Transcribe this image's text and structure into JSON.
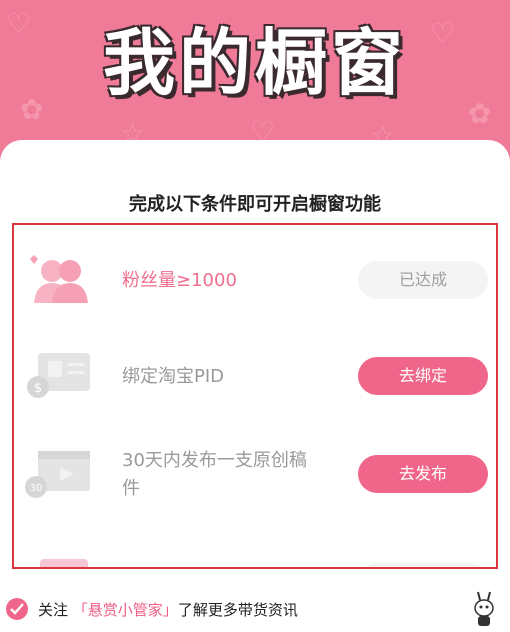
{
  "hero": {
    "title": "我的橱窗"
  },
  "card": {
    "title": "完成以下条件即可开启橱窗功能"
  },
  "requirements": [
    {
      "label": "粉丝量≥1000",
      "status": "done",
      "button": "已达成",
      "icon": "fans-icon"
    },
    {
      "label": "绑定淘宝PID",
      "status": "todo",
      "button": "去绑定",
      "icon": "id-card-icon"
    },
    {
      "label": "30天内发布一支原创稿件",
      "status": "todo",
      "button": "去发布",
      "icon": "video-icon"
    }
  ],
  "footer": {
    "prefix": "关注",
    "link": "「悬赏小管家」",
    "suffix": "了解更多带货资讯",
    "checkbox_checked": true
  },
  "colors": {
    "brand_pink": "#f0668a",
    "hero_bg": "#f07b98",
    "highlight_border": "#d9363e"
  }
}
